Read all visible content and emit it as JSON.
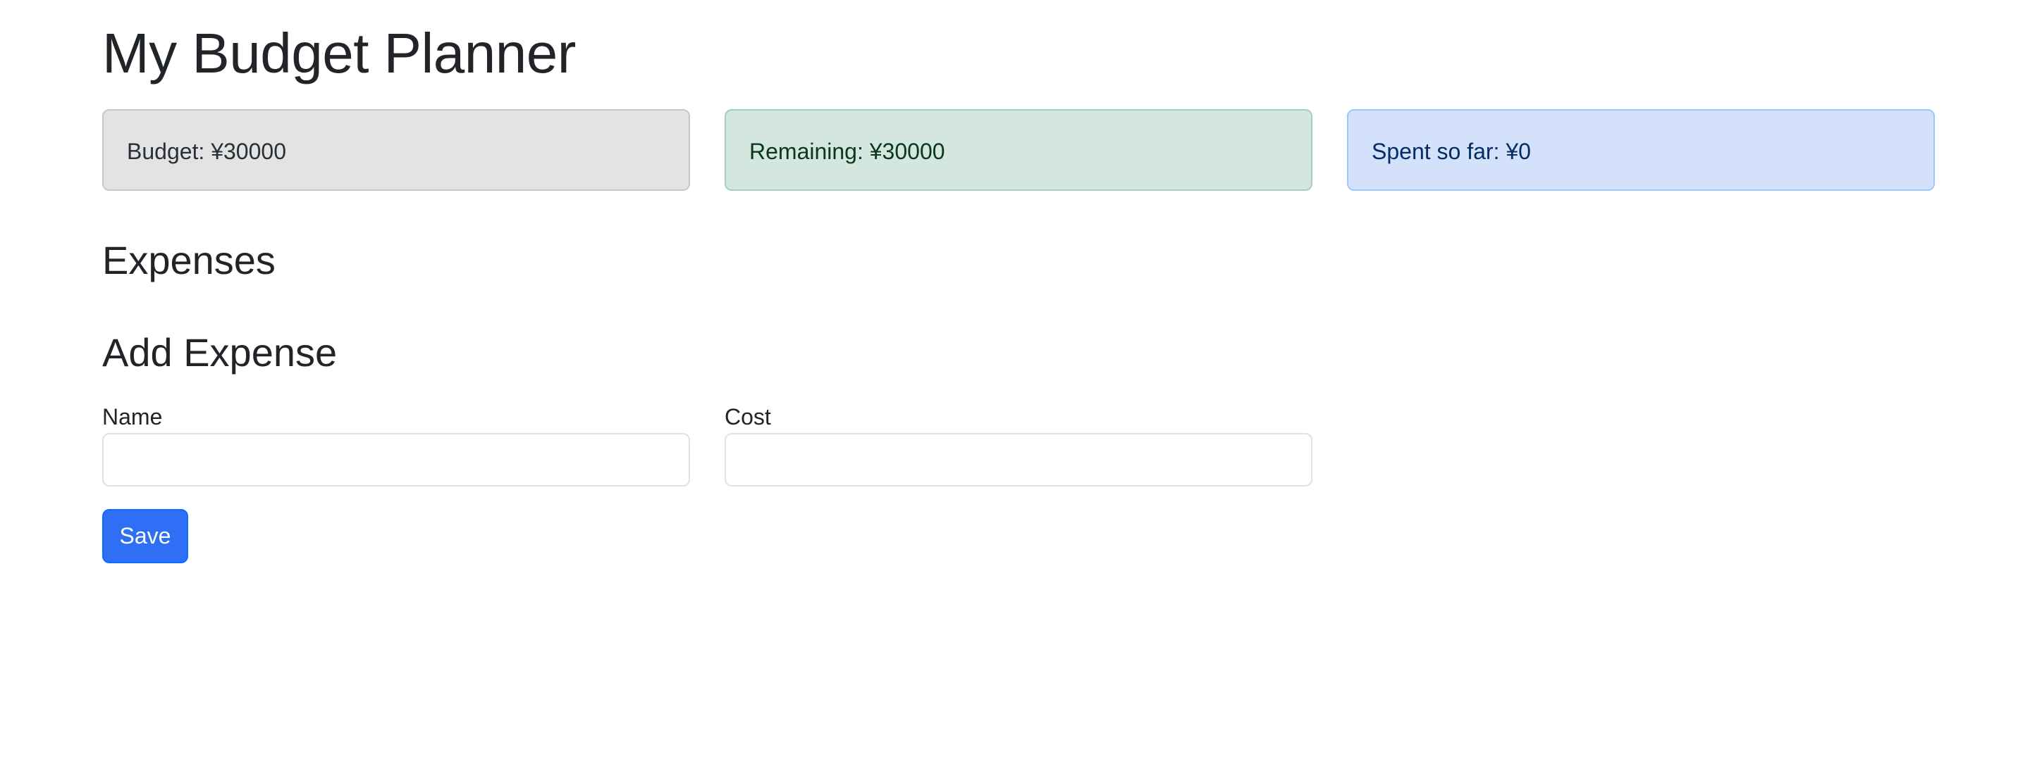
{
  "page": {
    "title": "My Budget Planner"
  },
  "summary": {
    "budget_text": "Budget: ¥30000",
    "remaining_text": "Remaining: ¥30000",
    "spent_text": "Spent so far: ¥0"
  },
  "expenses": {
    "heading": "Expenses",
    "items": []
  },
  "add_expense": {
    "heading": "Add Expense",
    "name_label": "Name",
    "name_value": "",
    "cost_label": "Cost",
    "cost_value": "",
    "save_label": "Save"
  },
  "colors": {
    "budget_bg": "#e2e3e5",
    "remaining_bg": "#d4e7de",
    "spent_bg": "#d3e1fb",
    "primary_button": "#2f6ff5"
  }
}
